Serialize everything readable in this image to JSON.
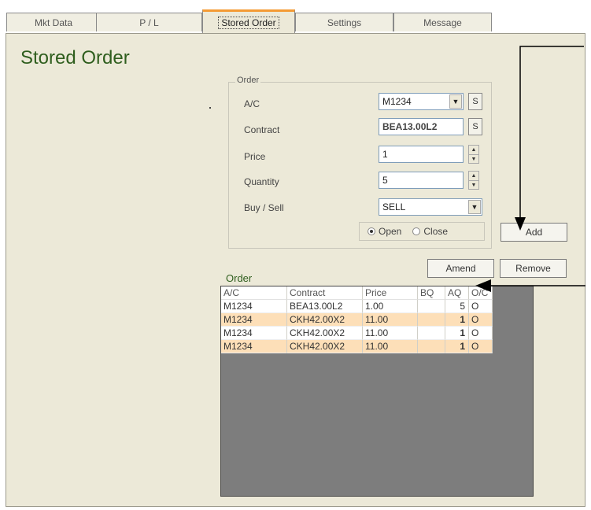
{
  "tabs": [
    {
      "label": "Mkt Data"
    },
    {
      "label": "P / L"
    },
    {
      "label": "Stored Order"
    },
    {
      "label": "Settings"
    },
    {
      "label": "Message"
    }
  ],
  "page": {
    "title": "Stored Order"
  },
  "order_form": {
    "group_label": "Order",
    "ac_label": "A/C",
    "ac_value": "M1234",
    "contract_label": "Contract",
    "contract_value": "BEA13.00L2",
    "price_label": "Price",
    "price_value": "1",
    "quantity_label": "Quantity",
    "quantity_value": "5",
    "buysell_label": "Buy / Sell",
    "buysell_value": "SELL",
    "s_button": "S",
    "open_label": "Open",
    "close_label": "Close",
    "selected_open_close": "Open"
  },
  "buttons": {
    "add": "Add",
    "amend": "Amend",
    "remove": "Remove"
  },
  "order_table": {
    "title": "Order",
    "columns": [
      "A/C",
      "Contract",
      "Price",
      "BQ",
      "AQ",
      "O/C"
    ],
    "rows": [
      [
        "M1234",
        "BEA13.00L2",
        "1.00",
        "",
        "5",
        "O"
      ],
      [
        "M1234",
        "CKH42.00X2",
        "11.00",
        "",
        "1",
        "O"
      ],
      [
        "M1234",
        "CKH42.00X2",
        "11.00",
        "",
        "1",
        "O"
      ],
      [
        "M1234",
        "CKH42.00X2",
        "11.00",
        "",
        "1",
        "O"
      ]
    ]
  },
  "colors": {
    "title": "#2f5e1e",
    "active_tab": "#f49a33",
    "row_alt": "#fddfb8",
    "panel": "#ece9d8"
  }
}
